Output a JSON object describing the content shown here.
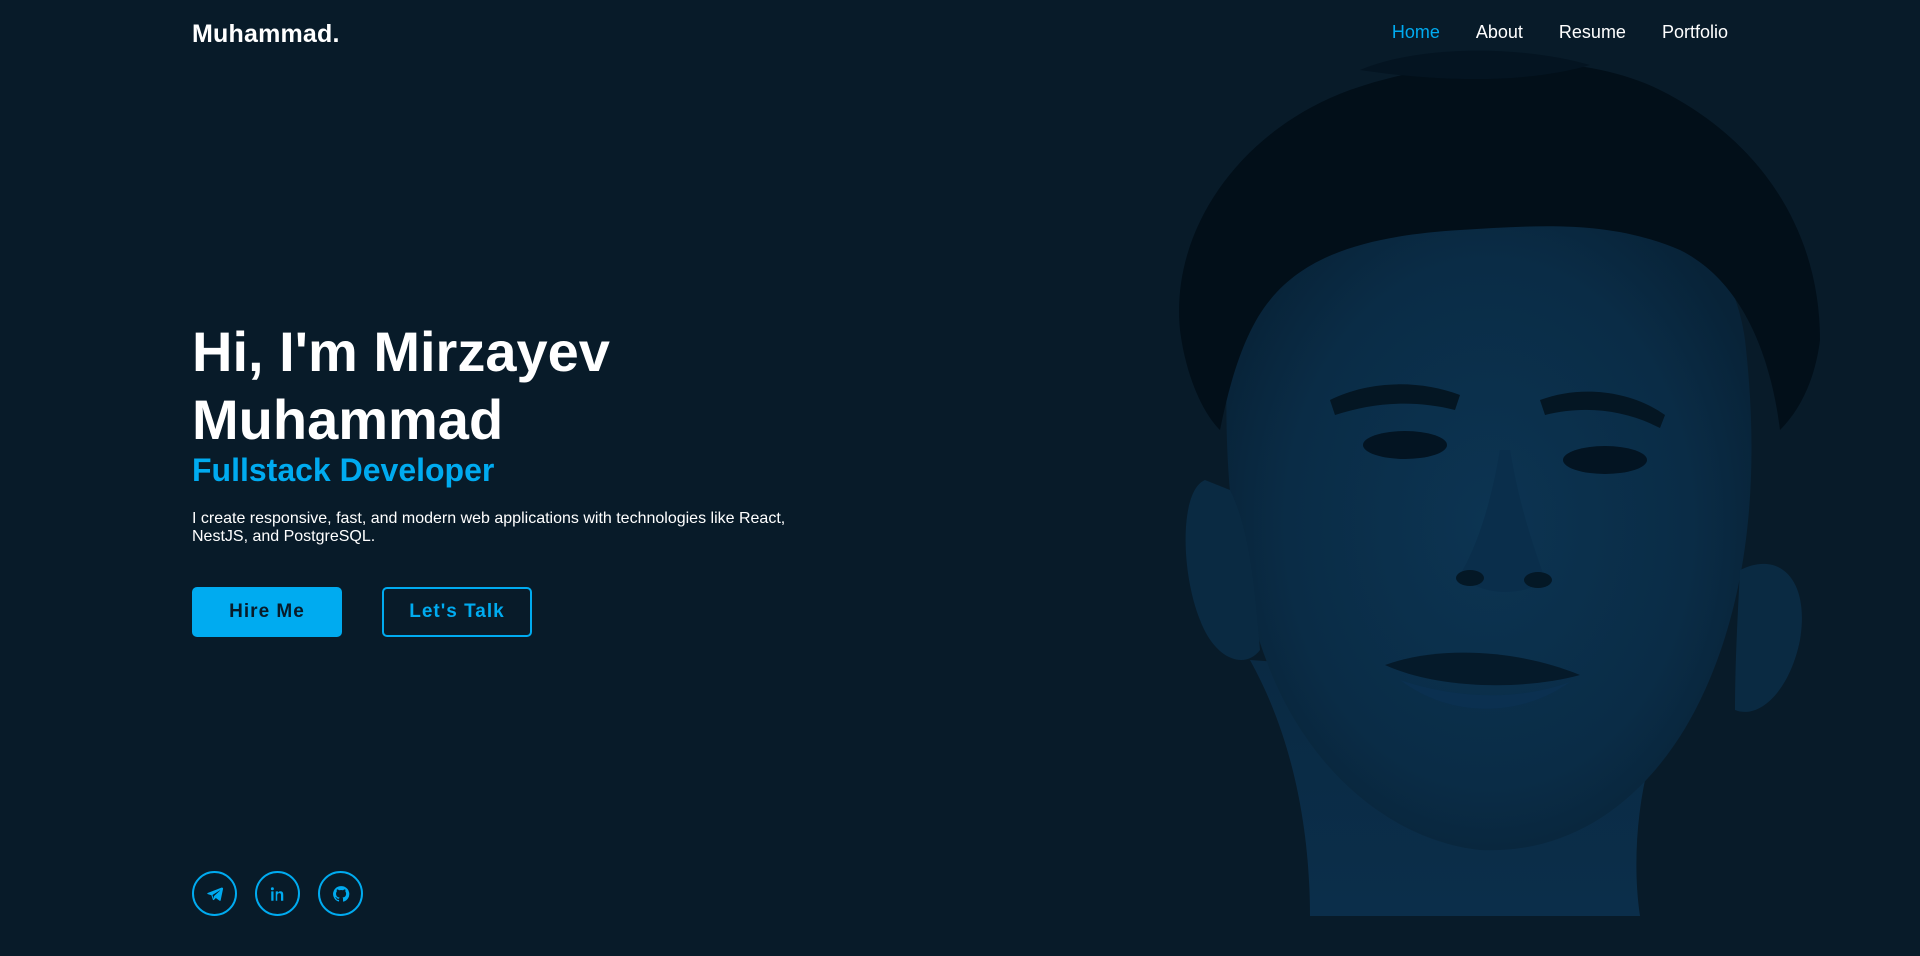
{
  "header": {
    "logo": "Muhammad.",
    "nav": [
      {
        "label": "Home",
        "active": true
      },
      {
        "label": "About",
        "active": false
      },
      {
        "label": "Resume",
        "active": false
      },
      {
        "label": "Portfolio",
        "active": false
      }
    ]
  },
  "hero": {
    "title": "Hi, I'm Mirzayev Muhammad",
    "role": "Fullstack Developer",
    "description": "I create responsive, fast, and modern web applications with technologies like React, NestJS, and PostgreSQL.",
    "primary_button": "Hire Me",
    "secondary_button": "Let's Talk"
  },
  "socials": [
    {
      "icon": "telegram-icon"
    },
    {
      "icon": "linkedin-icon"
    },
    {
      "icon": "github-icon"
    }
  ],
  "colors": {
    "background": "#081b29",
    "accent": "#00abf0",
    "text": "#ffffff"
  }
}
